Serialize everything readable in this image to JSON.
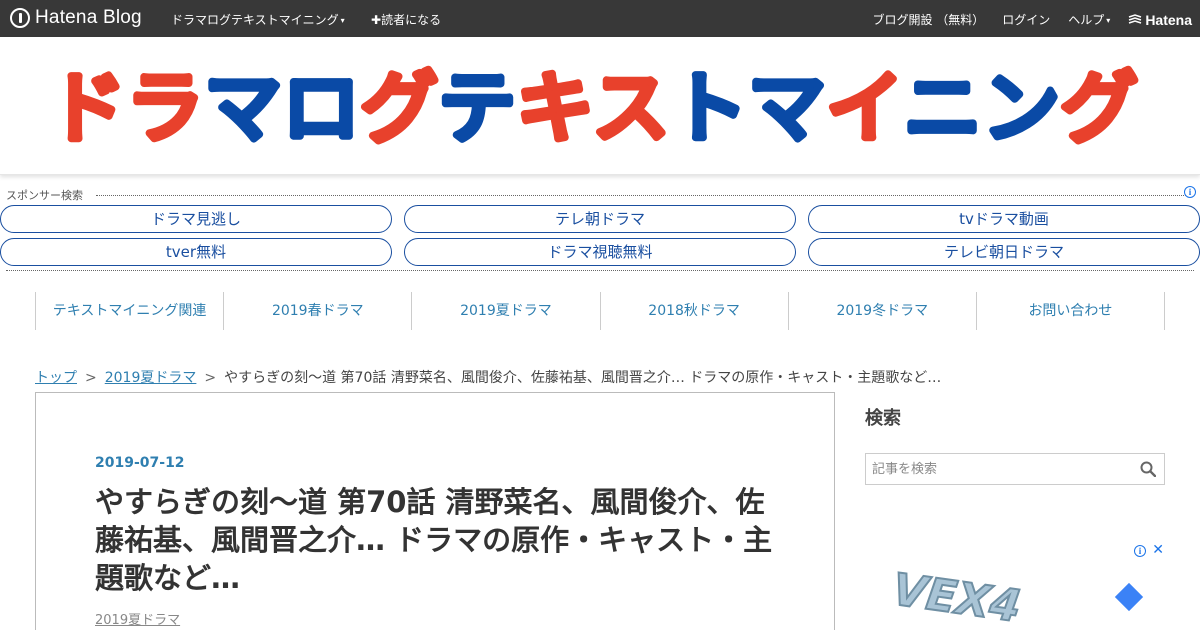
{
  "topbar": {
    "brand": "Hatena Blog",
    "blog_menu": "ドラマログテキストマイニング",
    "reader": "読者になる",
    "open_blog": "ブログ開設 （無料）",
    "login": "ログイン",
    "help": "ヘルプ",
    "hatena": "Hatena"
  },
  "header": {
    "logo_text": "ドラマログテキストマイニング"
  },
  "sponsor": {
    "label": "スポンサー検索",
    "info": "i",
    "links": [
      "ドラマ見逃し",
      "テレ朝ドラマ",
      "tvドラマ動画",
      "tver無料",
      "ドラマ視聴無料",
      "テレビ朝日ドラマ"
    ]
  },
  "categories": [
    "テキストマイニング関連",
    "2019春ドラマ",
    "2019夏ドラマ",
    "2018秋ドラマ",
    "2019冬ドラマ",
    "お問い合わせ"
  ],
  "breadcrumb": {
    "top": "トップ",
    "sep": ">",
    "category": "2019夏ドラマ",
    "current": "やすらぎの刻～道 第70話 清野菜名、風間俊介、佐藤祐基、風間晋之介… ドラマの原作・キャスト・主題歌など…"
  },
  "article": {
    "date": "2019-07-12",
    "title": "やすらぎの刻～道 第70話 清野菜名、風間俊介、佐藤祐基、風間晋之介… ドラマの原作・キャスト・主題歌など…",
    "category": "2019夏ドラマ"
  },
  "sidebar": {
    "search_title": "検索",
    "search_placeholder": "記事を検索"
  },
  "ad": {
    "info": "i",
    "close": "✕",
    "brand_logo": "VEX4"
  },
  "colors": {
    "topbar": "#383838",
    "logo_red": "#e8412c",
    "logo_blue": "#0a4aa6",
    "link": "#2f7fb0",
    "pill": "#1a4fa0"
  }
}
